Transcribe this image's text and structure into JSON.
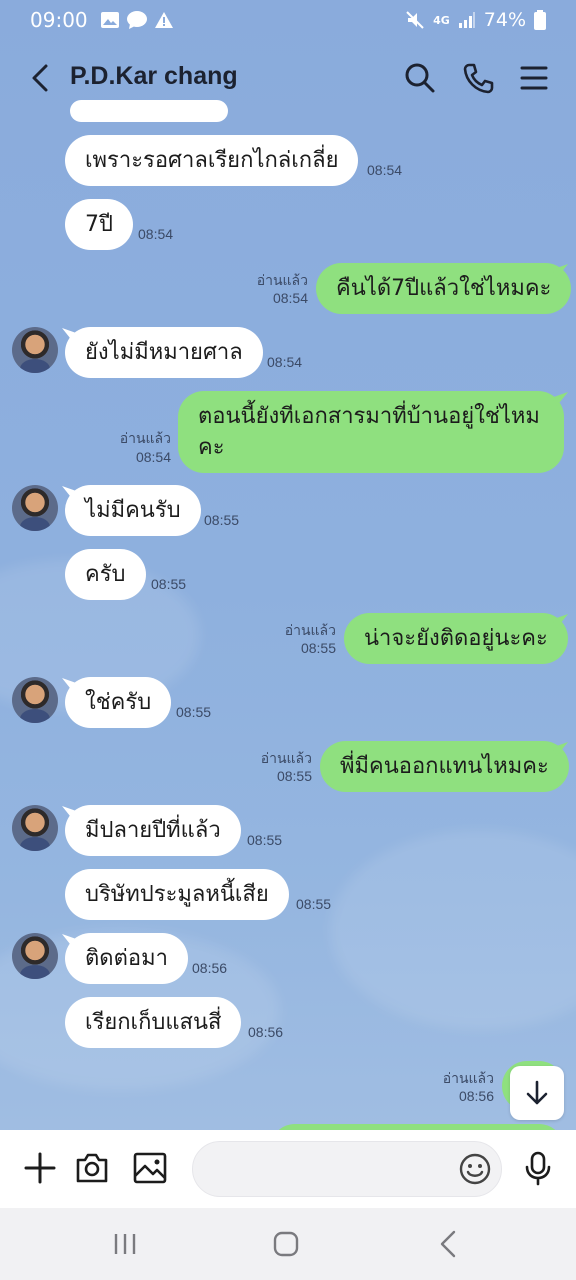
{
  "status_bar": {
    "time": "09:00",
    "network": "4G",
    "battery": "74%"
  },
  "header": {
    "title": "P.D.Kar chang"
  },
  "read_label": "อ่านแล้ว",
  "messages": [
    {
      "text": "เพราะรอศาลเรียกไกล่เกลี่ย",
      "time": "08:54"
    },
    {
      "text": "7ปี",
      "time": "08:54"
    },
    {
      "text": "คืนได้7ปีแล้วใช่ไหมคะ",
      "time": "08:54"
    },
    {
      "text": "ยังไม่มีหมายศาล",
      "time": "08:54"
    },
    {
      "text": "ตอนนี้ยังทีเอกสารมาที่บ้านอยู่ใช่ไหม คะ",
      "time": "08:54"
    },
    {
      "text": "ไม่มีคนรับ",
      "time": "08:55"
    },
    {
      "text": "ครับ",
      "time": "08:55"
    },
    {
      "text": "น่าจะยังติดอยู่นะคะ",
      "time": "08:55"
    },
    {
      "text": "ใช่ครับ",
      "time": "08:55"
    },
    {
      "text": "พี่มีคนออกแทนไหมคะ",
      "time": "08:55"
    },
    {
      "text": "มีปลายปีที่แล้ว",
      "time": "08:55"
    },
    {
      "text": "บริษัทประมูลหนี้เสีย",
      "time": "08:55"
    },
    {
      "text": "ติดต่อมา",
      "time": "08:56"
    },
    {
      "text": "เรียกเก็บแสนสี่",
      "time": "08:56"
    },
    {
      "text": "",
      "time": "08:56"
    }
  ],
  "input": {
    "placeholder": ""
  }
}
